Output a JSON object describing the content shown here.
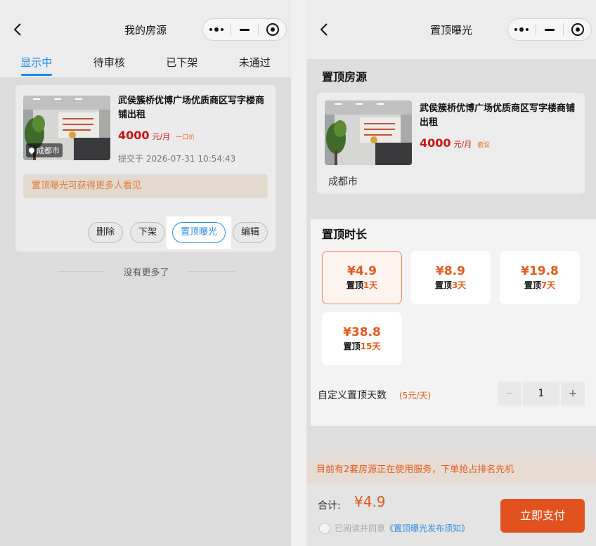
{
  "left": {
    "nav_title": "我的房源",
    "tabs": [
      {
        "label": "显示中",
        "active": true
      },
      {
        "label": "待审核",
        "active": false
      },
      {
        "label": "已下架",
        "active": false
      },
      {
        "label": "未通过",
        "active": false
      }
    ],
    "listing": {
      "title": "武侯簇桥优博广场优质商区写字楼商铺出租",
      "price": "4000",
      "unit": "元/月",
      "tag": "一口价",
      "location": "成都市",
      "submit_time": "提交于 2026-07-31 10:54:43",
      "tip": "置顶曝光可获得更多人看见",
      "actions": {
        "delete": "删除",
        "offline": "下架",
        "promote": "置顶曝光",
        "edit": "编辑"
      }
    },
    "no_more": "没有更多了"
  },
  "right": {
    "nav_title": "置顶曝光",
    "section_listing": "置顶房源",
    "listing": {
      "title": "武侯簇桥优博广场优质商区写字楼商铺出租",
      "price": "4000",
      "unit": "元/月",
      "tag": "面议",
      "city": "成都市"
    },
    "section_duration": "置顶时长",
    "options": [
      {
        "price": "¥4.9",
        "prefix": "置顶",
        "days": "1天",
        "selected": true
      },
      {
        "price": "¥8.9",
        "prefix": "置顶",
        "days": "3天",
        "selected": false
      },
      {
        "price": "¥19.8",
        "prefix": "置顶",
        "days": "7天",
        "selected": false
      },
      {
        "price": "¥38.8",
        "prefix": "置顶",
        "days": "15天",
        "selected": false
      }
    ],
    "custom_label": "自定义置顶天数",
    "custom_rate": "(5元/天)",
    "stepper": {
      "minus": "−",
      "value": "1",
      "plus": "+"
    },
    "notice": "目前有2套房源正在使用服务，下单抢占排名先机",
    "total_label": "合计:",
    "total_value": "¥4.9",
    "agree_text": "已阅读并同意",
    "agree_link": "《置顶曝光发布须知》",
    "pay_label": "立即支付"
  },
  "colors": {
    "accent_blue": "#1e88e5",
    "accent_orange": "#e05b1f",
    "price_red": "#c81414"
  },
  "icons": {
    "back": "chevron-left-icon",
    "more": "more-dots-icon",
    "minimize": "minus-icon",
    "close": "target-circle-icon",
    "location": "location-pin-icon"
  }
}
